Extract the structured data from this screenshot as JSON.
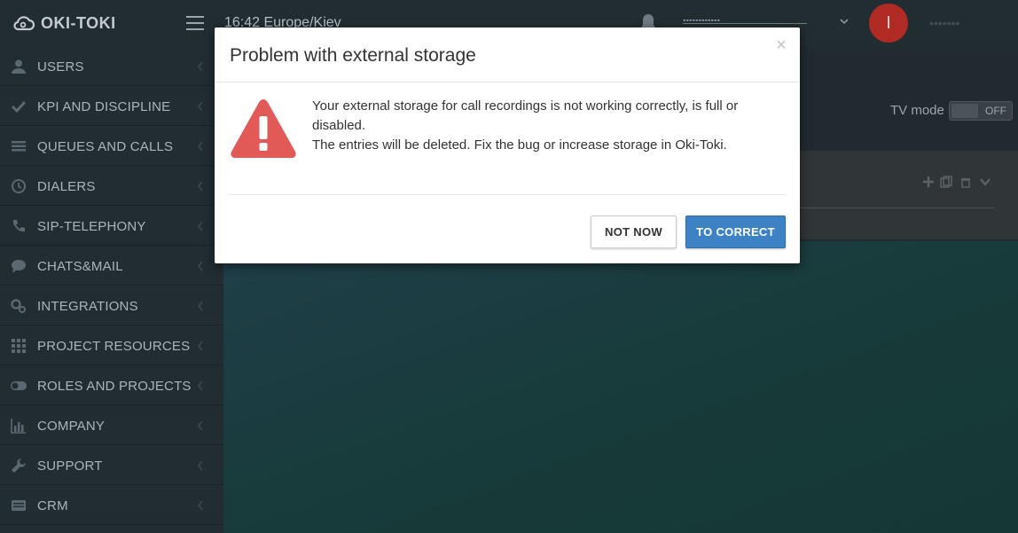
{
  "topbar": {
    "logo_text": "OKI-TOKI",
    "clock": "16:42  Europe/Kiev",
    "user_name": "••••••••••••",
    "avatar_letter": "I",
    "right_text": "•••••••"
  },
  "sidebar": {
    "items": [
      {
        "label": "USERS",
        "icon": "user-icon"
      },
      {
        "label": "KPI AND DISCIPLINE",
        "icon": "check-icon"
      },
      {
        "label": "QUEUES AND CALLS",
        "icon": "list-icon"
      },
      {
        "label": "DIALERS",
        "icon": "clock-icon"
      },
      {
        "label": "SIP-TELEPHONY",
        "icon": "phone-icon"
      },
      {
        "label": "CHATS&MAIL",
        "icon": "chat-icon"
      },
      {
        "label": "INTEGRATIONS",
        "icon": "gears-icon"
      },
      {
        "label": "PROJECT RESOURCES",
        "icon": "grid-icon"
      },
      {
        "label": "ROLES AND PROJECTS",
        "icon": "toggle-icon"
      },
      {
        "label": "COMPANY",
        "icon": "bar-chart-icon"
      },
      {
        "label": "SUPPORT",
        "icon": "wrench-icon"
      },
      {
        "label": "CRM",
        "icon": "card-icon"
      }
    ]
  },
  "main": {
    "tv_mode_label": "TV mode",
    "tv_mode_state": "OFF"
  },
  "modal": {
    "title": "Problem with external storage",
    "close_symbol": "×",
    "line1": "Your external storage for call recordings is not working correctly, is full or disabled.",
    "line2": "The entries will be deleted. Fix the bug or increase storage in Oki-Toki.",
    "btn_not_now": "NOT NOW",
    "btn_correct": "TO CORRECT"
  },
  "colors": {
    "primary_button": "#3c82c4",
    "warning_red": "#e25a58",
    "sidebar_bg": "#222d32",
    "avatar_red": "#b22a24"
  }
}
